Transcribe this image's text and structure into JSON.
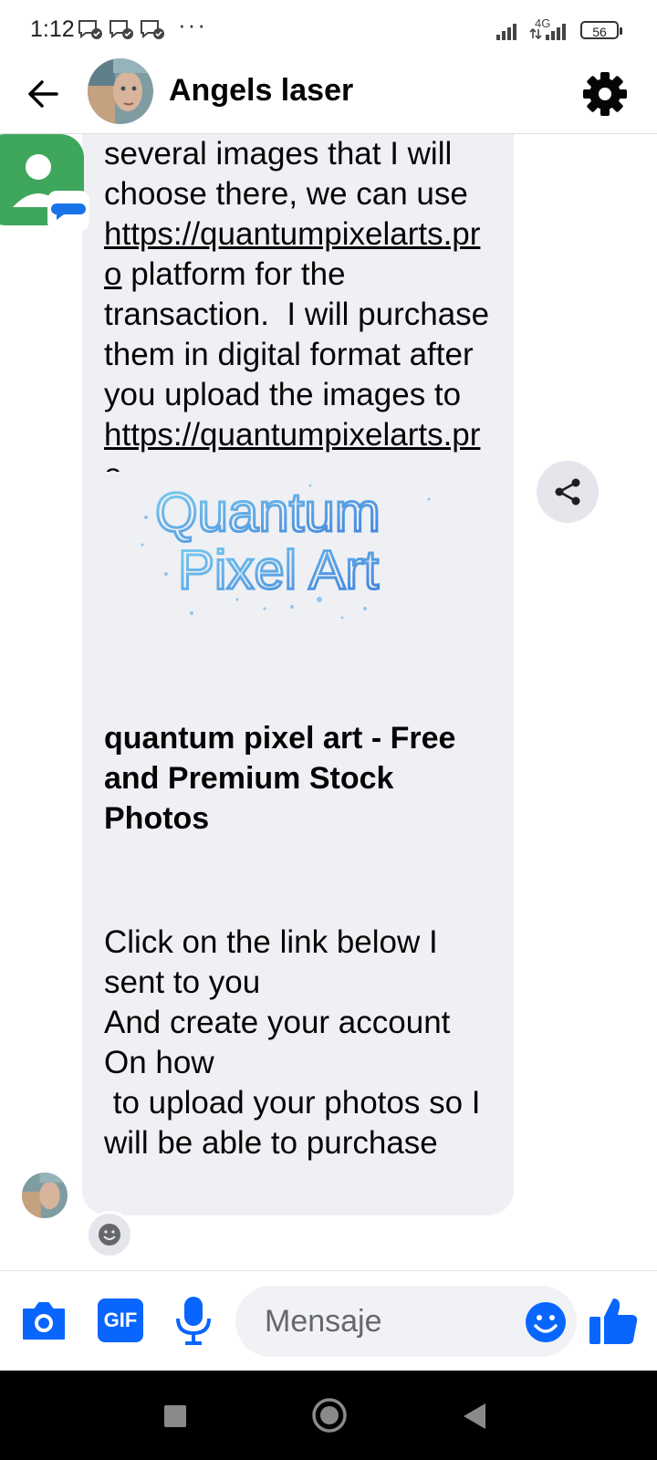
{
  "status_bar": {
    "time": "1:12",
    "overflow": "···",
    "network": "4G",
    "battery": "56"
  },
  "header": {
    "title": "Angels laser"
  },
  "messages": {
    "bubble1": {
      "text_before_link1": "several images that I will choose there, we can use ",
      "link1": "https://quantumpixelarts.pro",
      "text_between": " platform for the transaction.  I will purchase them in digital format after you upload the images to ",
      "link2": "https://quantumpixelarts.pro",
      "preview_logo_line1": "Quantum",
      "preview_logo_line2": "Pixel Art",
      "preview_title": "quantum pixel art - Free and Premium Stock Photos"
    },
    "bubble2": {
      "text": "Click on the link below I sent to you\nAnd create your account On how\n to upload your photos so I will be able to purchase"
    }
  },
  "composer": {
    "placeholder": "Mensaje",
    "gif_label": "GIF"
  },
  "colors": {
    "accent": "#0866ff",
    "bubble": "#eff0f4"
  },
  "icons": [
    "back-arrow-icon",
    "settings-gear-icon",
    "share-icon",
    "camera-icon",
    "gif-icon",
    "microphone-icon",
    "emoji-icon",
    "thumbs-up-icon",
    "recents-square-icon",
    "home-circle-icon",
    "back-triangle-icon"
  ]
}
